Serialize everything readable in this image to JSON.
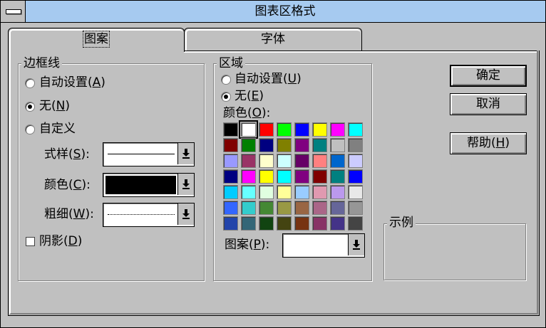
{
  "window": {
    "title": "图表区格式",
    "menu_icon": "system-menu-icon"
  },
  "tabs": [
    {
      "label": "图案",
      "active": true
    },
    {
      "label": "字体",
      "active": false
    }
  ],
  "border_group": {
    "title": "边框线",
    "options": [
      {
        "label": "自动设置(A)",
        "pre": "自动设置(",
        "key": "A",
        "post": ")",
        "checked": false
      },
      {
        "label": "无(N)",
        "pre": "无(",
        "key": "N",
        "post": ")",
        "checked": true
      },
      {
        "label": "自定义",
        "checked": false
      }
    ],
    "style": {
      "pre": "式样(",
      "key": "S",
      "post": "):"
    },
    "color": {
      "pre": "颜色(",
      "key": "C",
      "post": "):",
      "value": "#000000"
    },
    "weight": {
      "pre": "粗细(",
      "key": "W",
      "post": "):"
    },
    "shadow": {
      "pre": "阴影(",
      "key": "D",
      "post": ")",
      "checked": false
    }
  },
  "area_group": {
    "title": "区域",
    "auto": {
      "pre": "自动设置(",
      "key": "U",
      "post": ")",
      "checked": false
    },
    "none": {
      "pre": "无(",
      "key": "E",
      "post": ")",
      "checked": true
    },
    "color_label": {
      "pre": "颜色(",
      "key": "O",
      "post": "):"
    },
    "palette": [
      [
        "#000000",
        "#ffffff",
        "#ff0000",
        "#00ff00",
        "#0000ff",
        "#ffff00",
        "#ff00ff",
        "#00ffff"
      ],
      [
        "#800000",
        "#008000",
        "#000080",
        "#808000",
        "#800080",
        "#008080",
        "#c0c0c0",
        "#808080"
      ],
      [
        "#9999ff",
        "#993366",
        "#ffffcc",
        "#ccffff",
        "#660066",
        "#ff8080",
        "#0066cc",
        "#ccccff"
      ],
      [
        "#000080",
        "#ff00ff",
        "#ffff00",
        "#00ffff",
        "#800080",
        "#800000",
        "#008080",
        "#0000ff"
      ],
      [
        "#00ccff",
        "#66ffff",
        "#e0ffe0",
        "#ffff99",
        "#99ccff",
        "#e099b0",
        "#bb99ee",
        "#e8e8e8"
      ],
      [
        "#3366ff",
        "#33cccc",
        "#448833",
        "#999944",
        "#996644",
        "#aa6688",
        "#666699",
        "#969696"
      ],
      [
        "#2244aa",
        "#336677",
        "#114411",
        "#444411",
        "#773311",
        "#883366",
        "#443388",
        "#444444"
      ]
    ],
    "selected_swatch": [
      0,
      1
    ],
    "pattern": {
      "pre": "图案(",
      "key": "P",
      "post": "):"
    }
  },
  "buttons": {
    "ok": "确定",
    "cancel": "取消",
    "help": {
      "pre": "帮助(",
      "key": "H",
      "post": ")"
    }
  },
  "sample_group": {
    "title": "示例"
  }
}
